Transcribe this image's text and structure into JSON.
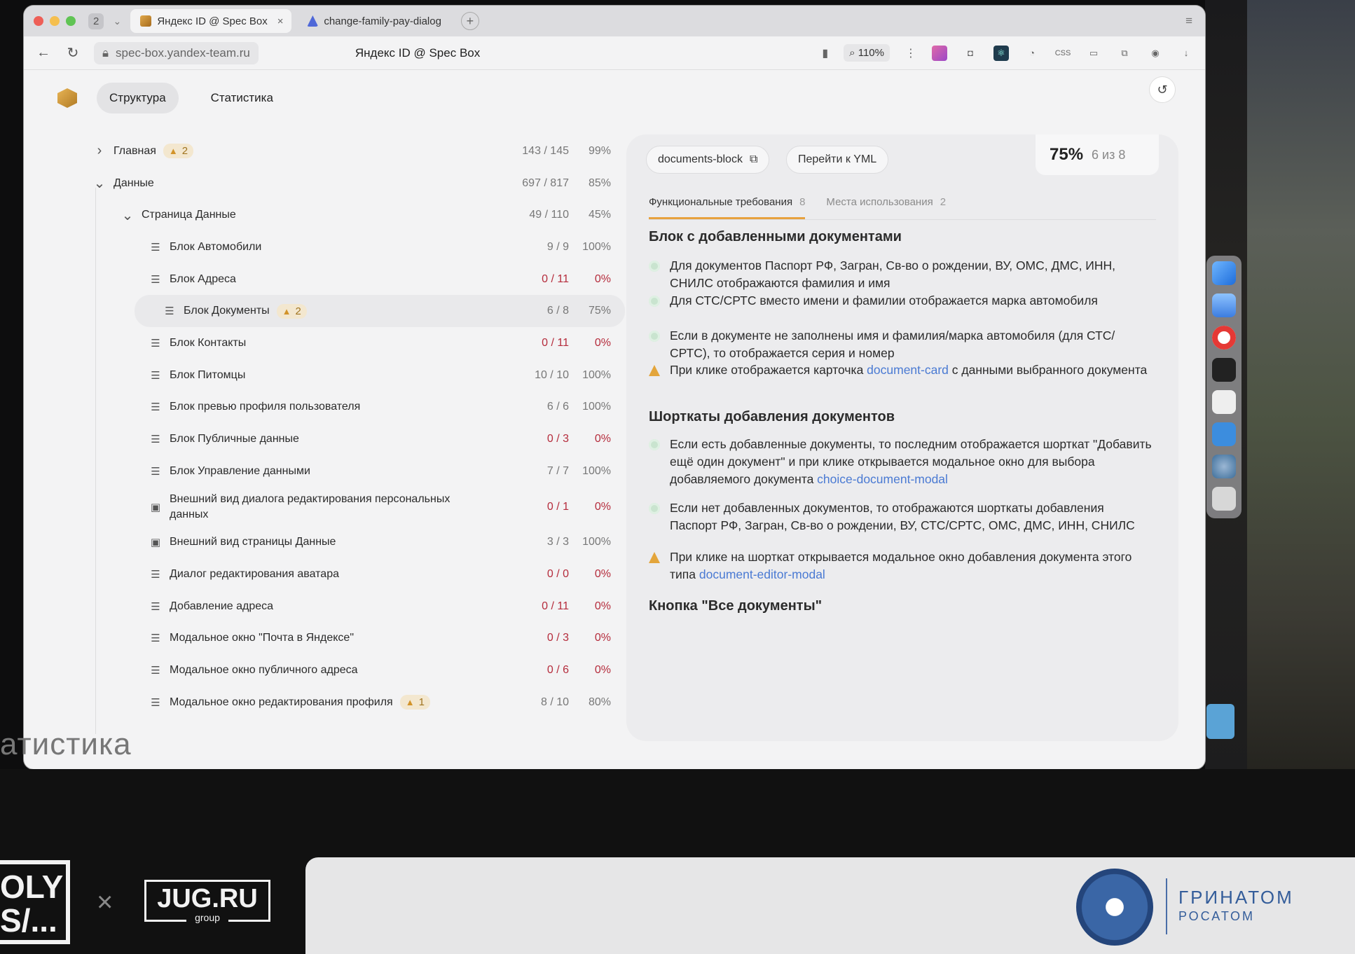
{
  "browser": {
    "tab_count": "2",
    "tabs": [
      {
        "title": "Яндекс ID @ Spec Box",
        "active": true
      },
      {
        "title": "change-family-pay-dialog",
        "active": false
      }
    ],
    "url": "spec-box.yandex-team.ru",
    "page_title": "Яндекс ID @ Spec Box",
    "zoom": "110%"
  },
  "app": {
    "nav": [
      "Структура",
      "Статистика"
    ]
  },
  "tree": [
    {
      "label": "Главная",
      "level": 0,
      "expanded": false,
      "warn": "2",
      "count": "143 / 145",
      "pct": "99%"
    },
    {
      "label": "Данные",
      "level": 0,
      "expanded": true,
      "count": "697 / 817",
      "pct": "85%"
    },
    {
      "label": "Страница Данные",
      "level": 1,
      "expanded": true,
      "count": "49 / 110",
      "pct": "45%"
    },
    {
      "label": "Блок Автомобили",
      "level": 2,
      "icon": "list",
      "count": "9 / 9",
      "pct": "100%"
    },
    {
      "label": "Блок Адреса",
      "level": 2,
      "icon": "list",
      "count": "0 / 11",
      "pct": "0%",
      "zero": true
    },
    {
      "label": "Блок Документы",
      "level": 2,
      "icon": "list",
      "warn": "2",
      "count": "6 / 8",
      "pct": "75%",
      "selected": true
    },
    {
      "label": "Блок Контакты",
      "level": 2,
      "icon": "list",
      "count": "0 / 11",
      "pct": "0%",
      "zero": true
    },
    {
      "label": "Блок Питомцы",
      "level": 2,
      "icon": "list",
      "count": "10 / 10",
      "pct": "100%"
    },
    {
      "label": "Блок превью профиля пользователя",
      "level": 2,
      "icon": "list",
      "count": "6 / 6",
      "pct": "100%"
    },
    {
      "label": "Блок Публичные данные",
      "level": 2,
      "icon": "list",
      "count": "0 / 3",
      "pct": "0%",
      "zero": true
    },
    {
      "label": "Блок Управление данными",
      "level": 2,
      "icon": "list",
      "count": "7 / 7",
      "pct": "100%"
    },
    {
      "label": "Внешний вид диалога редактирования персональных данных",
      "level": 2,
      "icon": "image",
      "count": "0 / 1",
      "pct": "0%",
      "zero": true,
      "tall": true
    },
    {
      "label": "Внешний вид страницы Данные",
      "level": 2,
      "icon": "image",
      "count": "3 / 3",
      "pct": "100%"
    },
    {
      "label": "Диалог редактирования аватара",
      "level": 2,
      "icon": "list",
      "count": "0 / 0",
      "pct": "0%",
      "zero": true
    },
    {
      "label": "Добавление адреса",
      "level": 2,
      "icon": "list",
      "count": "0 / 11",
      "pct": "0%",
      "zero": true
    },
    {
      "label": "Модальное окно \"Почта в Яндексе\"",
      "level": 2,
      "icon": "list",
      "count": "0 / 3",
      "pct": "0%",
      "zero": true
    },
    {
      "label": "Модальное окно публичного адреса",
      "level": 2,
      "icon": "list",
      "count": "0 / 6",
      "pct": "0%",
      "zero": true
    },
    {
      "label": "Модальное окно редактирования профиля",
      "level": 2,
      "icon": "list",
      "warn": "1",
      "count": "8 / 10",
      "pct": "80%"
    }
  ],
  "detail": {
    "block_id": "documents-block",
    "yml_button": "Перейти к YML",
    "score_pct": "75%",
    "score_count": "6 из 8",
    "tabs": [
      {
        "label": "Функциональные требования",
        "count": "8",
        "active": true
      },
      {
        "label": "Места использования",
        "count": "2",
        "active": false
      }
    ],
    "sections": [
      {
        "title": "Блок с добавленными документами",
        "items": [
          {
            "status": "ok",
            "text": "Для документов Паспорт РФ, Загран, Св-во о рождении, ВУ, ОМС, ДМС, ИНН, СНИЛС отображаются фамилия и имя"
          },
          {
            "status": "ok",
            "text": "Для СТС/СРТС вместо имени и фамилии отображается марка автомобиля"
          },
          {
            "status": "ok",
            "text": "Если в документе не заполнены имя и фамилия/марка автомобиля (для СТС/СРТС), то отображается серия и номер"
          },
          {
            "status": "warn",
            "text": "При клике отображается карточка ",
            "link": "document-card",
            "text_after": " с данными выбранного документа"
          }
        ]
      },
      {
        "title": "Шорткаты добавления документов",
        "items": [
          {
            "status": "ok",
            "text": "Если есть добавленные документы, то последним отображается шорткат \"Добавить ещё один документ\" и при клике открывается модальное окно для выбора добавляемого документа ",
            "link": "choice-document-modal"
          },
          {
            "status": "ok",
            "text": "Если нет добавленных документов, то отображаются шорткаты добавления Паспорт РФ, Загран, Св-во о рождении, ВУ, СТС/СРТС, ОМС, ДМС, ИНН, СНИЛС"
          },
          {
            "status": "warn",
            "text": "При клике на шорткат открывается модальное окно добавления документа этого типа ",
            "link": "document-editor-modal"
          }
        ]
      },
      {
        "title": "Кнопка \"Все документы\"",
        "items": []
      }
    ]
  },
  "overlay": {
    "caption": "атистика"
  },
  "footer": {
    "left_logo": "OLY\nS/...",
    "separator": "×",
    "partner": "JUG.RU",
    "partner_sub": "group",
    "sponsor_name": "ГРИНАТОМ",
    "sponsor_sub": "РОСАТОМ"
  },
  "colors": {
    "zero_value": "#b52c3c",
    "warning": "#e3a53b",
    "link": "#4a7ad3",
    "tab_underline": "#e7a13e"
  }
}
